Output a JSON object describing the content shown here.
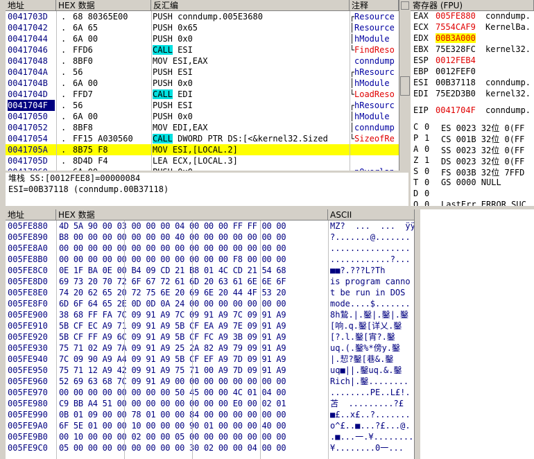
{
  "disasm": {
    "headers": {
      "addr": "地址",
      "hex": "HEX 数据",
      "asm": "反汇编",
      "comment": "注释"
    },
    "rows": [
      {
        "addr": "0041703D",
        "mk": ".",
        "hex": "68 80365E00",
        "asm": "PUSH conndump.005E3680",
        "call": "",
        "asm2": "",
        "cmt": "Resource",
        "cmtc": "blue",
        "br": "┌"
      },
      {
        "addr": "00417042",
        "mk": ".",
        "hex": "6A 65",
        "asm": "PUSH 0x65",
        "call": "",
        "asm2": "",
        "cmt": "Resource",
        "cmtc": "blue",
        "br": "│"
      },
      {
        "addr": "00417044",
        "mk": ".",
        "hex": "6A 00",
        "asm": "PUSH 0x0",
        "call": "",
        "asm2": "",
        "cmt": "hModule",
        "cmtc": "blue",
        "br": "│"
      },
      {
        "addr": "00417046",
        "mk": ".",
        "hex": "FFD6",
        "asm": "",
        "call": "CALL",
        "asm2": " ESI",
        "cmt": "FindReso",
        "cmtc": "red",
        "br": "└"
      },
      {
        "addr": "00417048",
        "mk": ".",
        "hex": "8BF0",
        "asm": "MOV ESI,EAX",
        "call": "",
        "asm2": "",
        "cmt": "conndump",
        "cmtc": "blue",
        "br": " "
      },
      {
        "addr": "0041704A",
        "mk": ".",
        "hex": "56",
        "asm": "PUSH ESI",
        "call": "",
        "asm2": "",
        "cmt": "hResourc",
        "cmtc": "blue",
        "br": "┌"
      },
      {
        "addr": "0041704B",
        "mk": ".",
        "hex": "6A 00",
        "asm": "PUSH 0x0",
        "call": "",
        "asm2": "",
        "cmt": "hModule",
        "cmtc": "blue",
        "br": "│"
      },
      {
        "addr": "0041704D",
        "mk": ".",
        "hex": "FFD7",
        "asm": "",
        "call": "CALL",
        "asm2": " EDI",
        "cmt": "LoadReso",
        "cmtc": "red",
        "br": "└"
      },
      {
        "addr": "0041704F",
        "mk": ".",
        "hex": "56",
        "asm": "PUSH ESI",
        "call": "",
        "asm2": "",
        "cmt": "hResourc",
        "cmtc": "blue",
        "br": "┌",
        "sel": true
      },
      {
        "addr": "00417050",
        "mk": ".",
        "hex": "6A 00",
        "asm": "PUSH 0x0",
        "call": "",
        "asm2": "",
        "cmt": "hModule",
        "cmtc": "blue",
        "br": "│"
      },
      {
        "addr": "00417052",
        "mk": ".",
        "hex": "8BF8",
        "asm": "MOV EDI,EAX",
        "call": "",
        "asm2": "",
        "cmt": "conndump",
        "cmtc": "blue",
        "br": "│"
      },
      {
        "addr": "00417054",
        "mk": ".",
        "hex": "FF15 A030560",
        "asm": "",
        "call": "CALL",
        "asm2": " DWORD PTR DS:[<&kernel32.Sized",
        "cmt": "SizeofRe",
        "cmtc": "red",
        "br": "└"
      },
      {
        "addr": "0041705A",
        "mk": ".",
        "hex": "8B75 F8",
        "asm": "MOV ESI,[LOCAL.2]",
        "call": "",
        "asm2": "",
        "cmt": "",
        "cmtc": "blue",
        "br": " ",
        "yellow": true
      },
      {
        "addr": "0041705D",
        "mk": ".",
        "hex": "8D4D F4",
        "asm": "LEA ECX,[LOCAL.3]",
        "call": "",
        "asm2": "",
        "cmt": "",
        "cmtc": "blue",
        "br": " "
      },
      {
        "addr": "00417060",
        "mk": ".",
        "hex": "6A 00",
        "asm": "PUSH 0x0",
        "call": "",
        "asm2": "",
        "cmt": "pOverlap",
        "cmtc": "blue",
        "br": "┌"
      }
    ]
  },
  "info": {
    "line1": "堆栈 SS:[0012FEE8]=00000084",
    "line2": "ESI=00B37118 (conndump.00B37118)"
  },
  "regs": {
    "header": "寄存器 (FPU)",
    "gp": [
      {
        "n": "EAX",
        "v": "005FE880",
        "d": "conndump.",
        "hl": "red"
      },
      {
        "n": "ECX",
        "v": "7554CAF9",
        "d": "KernelBa.",
        "hl": "red"
      },
      {
        "n": "EDX",
        "v": "00B3A000",
        "d": "",
        "hl": "yel"
      },
      {
        "n": "EBX",
        "v": "75E328FC",
        "d": "kernel32.",
        "hl": ""
      },
      {
        "n": "ESP",
        "v": "0012FEB4",
        "d": "",
        "hl": "red"
      },
      {
        "n": "EBP",
        "v": "0012FEF0",
        "d": "",
        "hl": ""
      },
      {
        "n": "ESI",
        "v": "00B37118",
        "d": "conndump.",
        "hl": ""
      },
      {
        "n": "EDI",
        "v": "75E2D3B0",
        "d": "kernel32.",
        "hl": ""
      }
    ],
    "eip": {
      "n": "EIP",
      "v": "0041704F",
      "d": "conndump."
    },
    "flags": [
      {
        "f": "C",
        "b": "0",
        "s": "ES 0023 32位 0(FF"
      },
      {
        "f": "P",
        "b": "1",
        "s": "CS 001B 32位 0(FF"
      },
      {
        "f": "A",
        "b": "0",
        "s": "SS 0023 32位 0(FF"
      },
      {
        "f": "Z",
        "b": "1",
        "s": "DS 0023 32位 0(FF"
      },
      {
        "f": "S",
        "b": "0",
        "s": "FS 003B 32位 7FFD"
      },
      {
        "f": "T",
        "b": "0",
        "s": "GS 0000 NULL"
      },
      {
        "f": "D",
        "b": "0",
        "s": ""
      },
      {
        "f": "O",
        "b": "0",
        "s": "LastErr ERROR_SUC"
      }
    ]
  },
  "dump": {
    "headers": {
      "addr": "地址",
      "hex": "HEX 数据",
      "ascii": "ASCII"
    },
    "rows": [
      {
        "a": "005FE880",
        "h": "4D 5A 90 00 03 00 00 00 04 00 00 00 FF FF 00 00",
        "s": "MZ?  ...  ...  ÿÿ.."
      },
      {
        "a": "005FE890",
        "h": "B8 00 00 00 00 00 00 00 40 00 00 00 00 00 00 00",
        "s": "?.......@......."
      },
      {
        "a": "005FE8A0",
        "h": "00 00 00 00 00 00 00 00 00 00 00 00 00 00 00 00",
        "s": "................"
      },
      {
        "a": "005FE8B0",
        "h": "00 00 00 00 00 00 00 00 00 00 00 00 F8 00 00 00",
        "s": "............?..."
      },
      {
        "a": "005FE8C0",
        "h": "0E 1F BA 0E 00 B4 09 CD 21 B8 01 4C CD 21 54 68",
        "s": "■■?.???L?Th"
      },
      {
        "a": "005FE8D0",
        "h": "69 73 20 70 72 6F 67 72 61 6D 20 63 61 6E 6E 6F",
        "s": "is program canno"
      },
      {
        "a": "005FE8E0",
        "h": "74 20 62 65 20 72 75 6E 20 69 6E 20 44 4F 53 20",
        "s": "t be run in DOS "
      },
      {
        "a": "005FE8F0",
        "h": "6D 6F 64 65 2E 0D 0D 0A 24 00 00 00 00 00 00 00",
        "s": "mode....$......."
      },
      {
        "a": "005FE900",
        "h": "38 68 FF FA 7C 09 91 A9 7C 09 91 A9 7C 09 91 A9",
        "s": "8h鷙.|.鑿|.鑿|.鑿"
      },
      {
        "a": "005FE910",
        "h": "5B CF EC A9 71 09 91 A9 5B CF EA A9 7E 09 91 A9",
        "s": "[响.q.鑿[详乂.鑿"
      },
      {
        "a": "005FE920",
        "h": "5B CF FF A9 6C 09 91 A9 5B CF FC A9 3B 09 91 A9",
        "s": "[?.l.鑿[宵?.鑿"
      },
      {
        "a": "005FE930",
        "h": "75 71 02 A9 7A 09 91 A9 25 2A 82 A9 79 09 91 A9",
        "s": "uq.(.鑿%*傍y.鑿"
      },
      {
        "a": "005FE940",
        "h": "7C 09 90 A9 A4 09 91 A9 5B CF EF A9 7D 09 91 A9",
        "s": "|.恝?鑿[巷&.鑿"
      },
      {
        "a": "005FE950",
        "h": "75 71 12 A9 42 09 91 A9 75 71 00 A9 7D 09 91 A9",
        "s": "uq■||.鑿uq.&.鑿"
      },
      {
        "a": "005FE960",
        "h": "52 69 63 68 7C 09 91 A9 00 00 00 00 00 00 00 00",
        "s": "Rich|.鑿........"
      },
      {
        "a": "005FE970",
        "h": "00 00 00 00 00 00 00 00 50 45 00 00 4C 01 04 00",
        "s": "........PE..L£!."
      },
      {
        "a": "005FE980",
        "h": "C9 BB A4 51 00 00 00 00 00 00 00 00 E0 00 02 01",
        "s": "苫  .........?£"
      },
      {
        "a": "005FE990",
        "h": "0B 01 09 00 00 78 01 00 00 84 00 00 00 00 00 00",
        "s": "■£..x£..?......."
      },
      {
        "a": "005FE9A0",
        "h": "6F 5E 01 00 00 10 00 00 00 90 01 00 00 00 40 00",
        "s": "o^£..■...?£...@."
      },
      {
        "a": "005FE9B0",
        "h": "00 10 00 00 00 02 00 00 05 00 00 00 00 00 00 00",
        "s": ".■...一.¥........"
      },
      {
        "a": "005FE9C0",
        "h": "05 00 00 00 00 00 00 00 00 30 02 00 00 04 00 00",
        "s": "¥........0一..."
      }
    ]
  }
}
